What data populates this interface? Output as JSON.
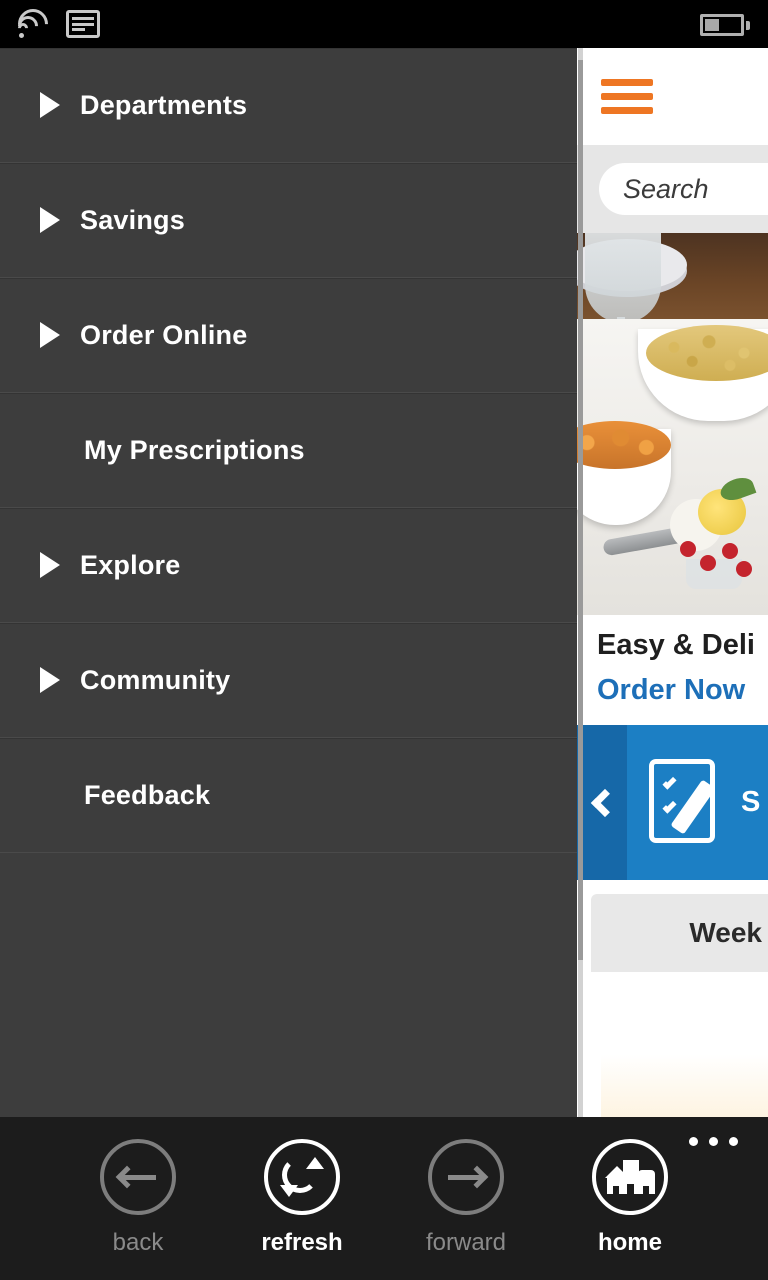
{
  "status_bar": {
    "wifi_icon": "wifi-icon",
    "sim_icon": "sim-card-icon",
    "battery_icon": "battery-icon",
    "battery_level_percent": 40
  },
  "sidebar": {
    "background_color": "#3d3d3d",
    "items": [
      {
        "label": "Departments",
        "has_arrow": true
      },
      {
        "label": "Savings",
        "has_arrow": true
      },
      {
        "label": "Order Online",
        "has_arrow": true
      },
      {
        "label": "My Prescriptions",
        "has_arrow": false
      },
      {
        "label": "Explore",
        "has_arrow": true
      },
      {
        "label": "Community",
        "has_arrow": true
      },
      {
        "label": "Feedback",
        "has_arrow": false
      }
    ]
  },
  "content": {
    "menu_icon": "hamburger-menu-icon",
    "menu_icon_color": "#ee7623",
    "search": {
      "placeholder": "Search"
    },
    "hero": {
      "image_alt": "casserole dishes, fruit cobbler and flower bouquet on a white table"
    },
    "promo": {
      "title": "Easy & Deli",
      "cta": "Order Now",
      "cta_color": "#1d6fb8"
    },
    "banner": {
      "icon": "clipboard-pencil-icon",
      "prev_icon": "chevron-left-icon",
      "text": "S",
      "background_color": "#1c7fc4"
    },
    "weekly_card": {
      "title": "Week"
    }
  },
  "nav_bar": {
    "background_color": "#1c1c1c",
    "overflow_icon": "ellipsis-icon",
    "buttons": [
      {
        "label": "back",
        "icon": "arrow-left-icon",
        "enabled": false
      },
      {
        "label": "refresh",
        "icon": "refresh-icon",
        "enabled": true
      },
      {
        "label": "forward",
        "icon": "arrow-right-icon",
        "enabled": false
      },
      {
        "label": "home",
        "icon": "home-buildings-icon",
        "enabled": true
      }
    ]
  }
}
